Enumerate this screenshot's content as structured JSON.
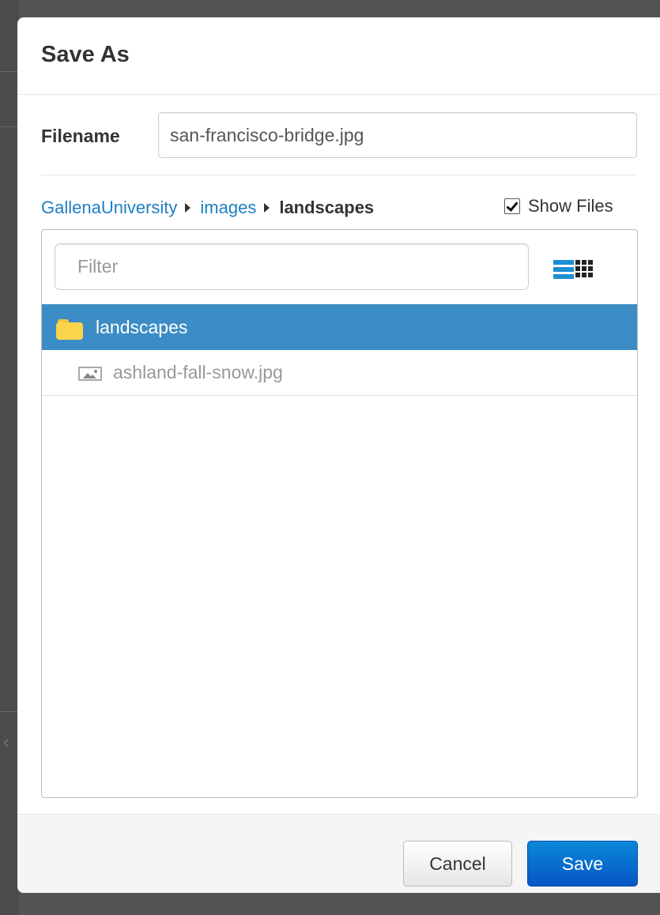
{
  "dialog": {
    "title": "Save As"
  },
  "filename": {
    "label": "Filename",
    "value": "san-francisco-bridge.jpg"
  },
  "breadcrumb": {
    "items": [
      {
        "label": "GallenaUniversity",
        "link": true
      },
      {
        "label": "images",
        "link": true
      },
      {
        "label": "landscapes",
        "link": false
      }
    ]
  },
  "show_files": {
    "label": "Show Files",
    "checked": true
  },
  "browser": {
    "filter_placeholder": "Filter",
    "view_modes": [
      "list-view-icon",
      "grid-view-icon"
    ],
    "active_view": "list",
    "rows": [
      {
        "type": "folder",
        "icon": "folder-icon",
        "label": "landscapes",
        "selected": true
      },
      {
        "type": "file",
        "icon": "image-file-icon",
        "label": "ashland-fall-snow.jpg",
        "selected": false
      }
    ]
  },
  "footer": {
    "cancel_label": "Cancel",
    "save_label": "Save"
  },
  "colors": {
    "link": "#1d7fc4",
    "selected_row": "#3c8dc5",
    "primary_button": "#0a6fd0",
    "folder": "#fbd44a"
  }
}
